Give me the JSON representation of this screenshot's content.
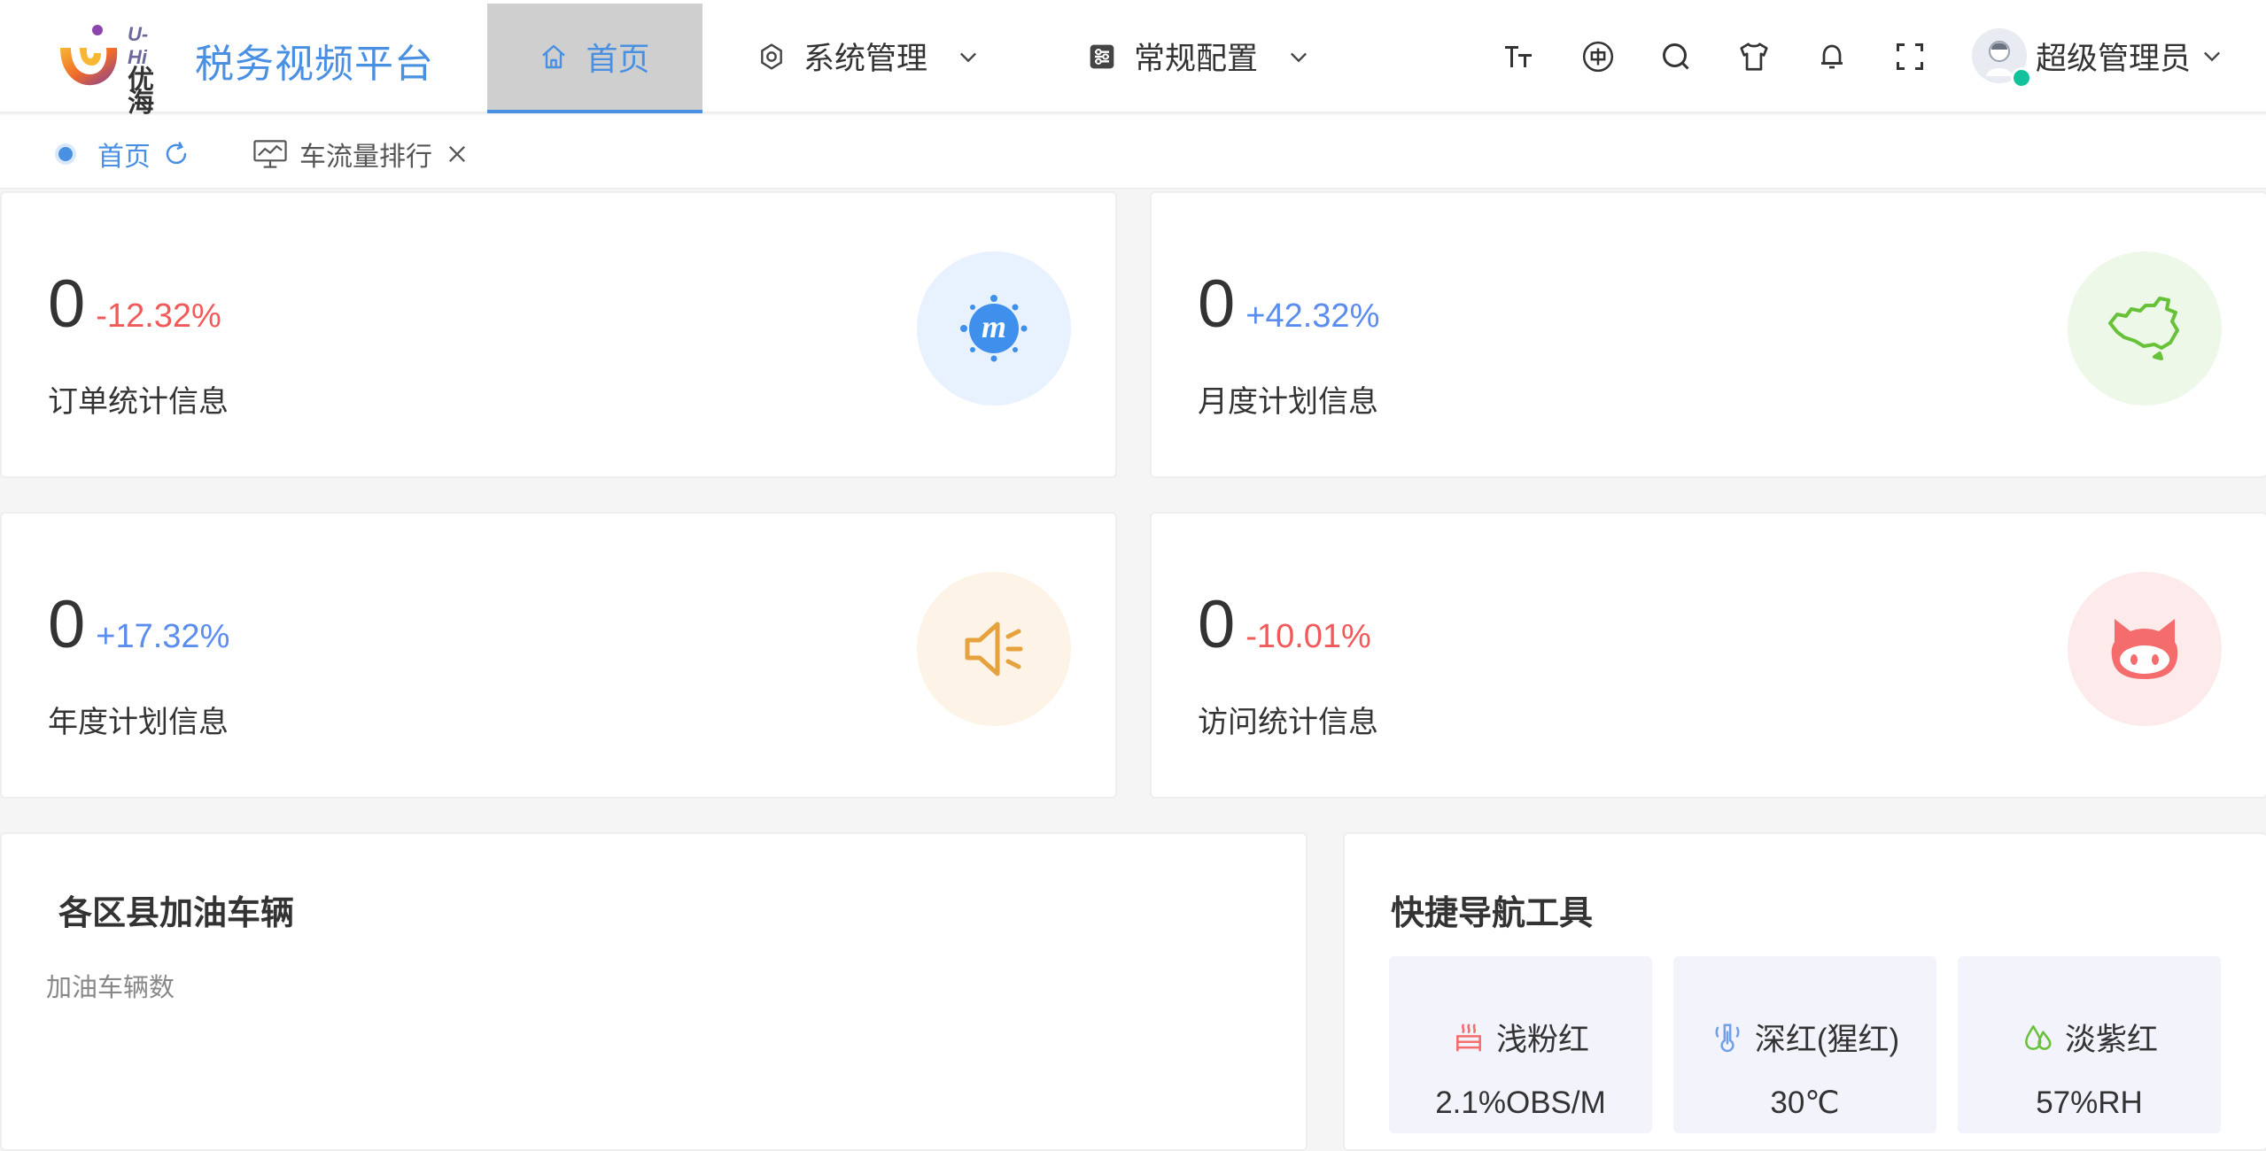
{
  "header": {
    "logo_en": "U-Hi",
    "logo_cn": "优海",
    "app_title": "税务视频平台",
    "nav": {
      "home": "首页",
      "system": "系统管理",
      "config": "常规配置"
    },
    "tools": [
      "font-size-icon",
      "language-icon",
      "search-icon",
      "theme-icon",
      "bell-icon",
      "fullscreen-icon"
    ],
    "user_name": "超级管理员"
  },
  "tabs": [
    {
      "label": "首页"
    },
    {
      "label": "车流量排行"
    }
  ],
  "stats": [
    {
      "value": "0",
      "change": "-12.32%",
      "label": "订单统计信息",
      "icon": "meetup-icon",
      "color": "#4a90e2"
    },
    {
      "value": "0",
      "change": "+42.32%",
      "label": "月度计划信息",
      "icon": "china-map-icon",
      "color": "#67c23a"
    },
    {
      "value": "0",
      "change": "+17.32%",
      "label": "年度计划信息",
      "icon": "speaker-icon",
      "color": "#e6a23c"
    },
    {
      "value": "0",
      "change": "-10.01%",
      "label": "访问统计信息",
      "icon": "github-icon",
      "color": "#f56c6c"
    }
  ],
  "fuel_panel": {
    "title": "各区县加油车辆",
    "subtitle": "加油车辆数"
  },
  "quick_nav": {
    "title": "快捷导航工具",
    "tiles": [
      {
        "label": "浅粉红",
        "value": "2.1%OBS/M",
        "icon": "heater-icon",
        "color": "#f56c6c"
      },
      {
        "label": "深红(猩红)",
        "value": "30℃",
        "icon": "temperature-icon",
        "color": "#6fa0e8"
      },
      {
        "label": "淡紫红",
        "value": "57%RH",
        "icon": "humidity-icon",
        "color": "#67c23a"
      }
    ]
  }
}
